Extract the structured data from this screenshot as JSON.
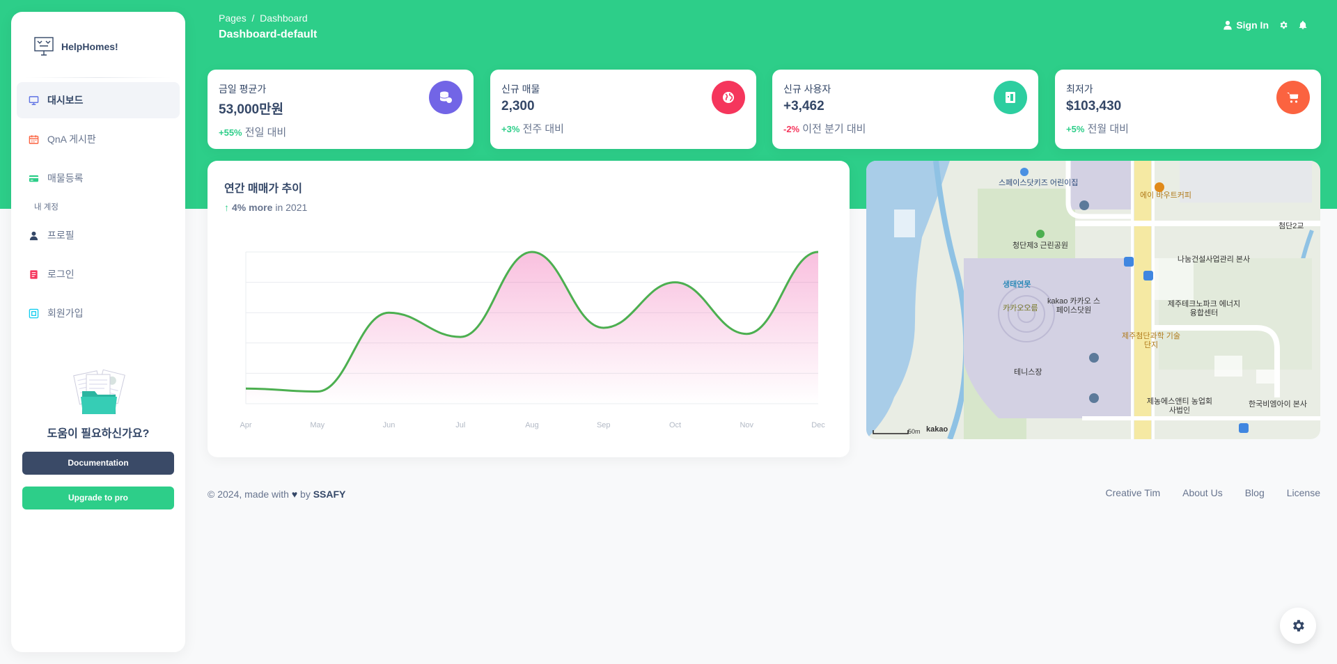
{
  "brand": {
    "name": "HelpHomes!"
  },
  "sidebar": {
    "items": [
      {
        "label": "대시보드",
        "icon": "monitor-icon",
        "active": true
      },
      {
        "label": "QnA 게시판",
        "icon": "calendar-icon"
      },
      {
        "label": "매물등록",
        "icon": "credit-card-icon"
      }
    ],
    "section_title": "내 계정",
    "account_items": [
      {
        "label": "프로필",
        "icon": "user-icon"
      },
      {
        "label": "로그인",
        "icon": "document-icon"
      },
      {
        "label": "회원가입",
        "icon": "id-card-icon"
      }
    ],
    "help_text": "도움이 필요하신가요?",
    "documentation_label": "Documentation",
    "upgrade_label": "Upgrade to pro"
  },
  "header": {
    "breadcrumb_root": "Pages",
    "breadcrumb_sep": "/",
    "breadcrumb_current": "Dashboard",
    "title": "Dashboard-default",
    "sign_in": "Sign In"
  },
  "stats": [
    {
      "label": "금일 평균가",
      "value": "53,000만원",
      "change": "+55%",
      "change_text": "전일 대비",
      "trend": "positive",
      "color": "#7265e6",
      "icon": "database-icon"
    },
    {
      "label": "신규 매물",
      "value": "2,300",
      "change": "+3%",
      "change_text": "전주 대비",
      "trend": "positive",
      "color": "#f5365c",
      "icon": "globe-icon"
    },
    {
      "label": "신규 사용자",
      "value": "+3,462",
      "change": "-2%",
      "change_text": "이전 분기 대비",
      "trend": "negative",
      "color": "#2dcea0",
      "icon": "document-icon"
    },
    {
      "label": "최저가",
      "value": "$103,430",
      "change": "+5%",
      "change_text": "전월 대비",
      "trend": "positive",
      "color": "#fb6340",
      "icon": "cart-icon"
    }
  ],
  "chart": {
    "title": "연간 매매가 추이",
    "sub_highlight": "4% more",
    "sub_rest": "in 2021"
  },
  "chart_data": {
    "type": "line",
    "title": "연간 매매가 추이",
    "categories": [
      "Apr",
      "May",
      "Jun",
      "Jul",
      "Aug",
      "Sep",
      "Oct",
      "Nov",
      "Dec"
    ],
    "series": [
      {
        "values": [
          50,
          40,
          300,
          220,
          500,
          250,
          400,
          230,
          500
        ]
      }
    ],
    "ylim": [
      0,
      500
    ],
    "grid": true,
    "line_color": "#4caf50",
    "fill_color": "#e91e8c"
  },
  "map": {
    "labels": [
      "스페이스닷키즈 어린이집",
      "청단제3 근린공원",
      "생태연못",
      "카카오오름",
      "kakao 카카오 스페이스닷원",
      "테니스장",
      "나눔건설사업관리 본사",
      "제주테크노파크 에너지융합센터",
      "제주첨단과학 기술단지",
      "제농에스앤티 농업회사법인",
      "한국비엠아이 본사",
      "에이 바우트커피",
      "첨단2교",
      "50m",
      "kakao"
    ]
  },
  "footer": {
    "copyright": "© 2024, made with",
    "by": "by",
    "author": "SSAFY",
    "links": [
      "Creative Tim",
      "About Us",
      "Blog",
      "License"
    ]
  }
}
